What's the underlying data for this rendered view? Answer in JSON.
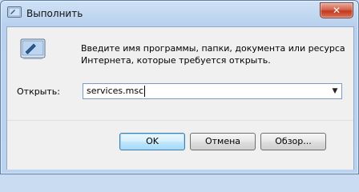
{
  "window": {
    "title": "Выполнить",
    "close_label": "✕"
  },
  "dialog": {
    "description": "Введите имя программы, папки, документа или ресурса Интернета, которые требуется открыть.",
    "open_label": "Открыть:",
    "command_value": "services.msc",
    "combo_arrow": "▼"
  },
  "buttons": {
    "ok": "OK",
    "cancel": "Отмена",
    "browse": "Обзор..."
  },
  "colors": {
    "titlebar": "#cfe1f5",
    "close_button": "#c2391f",
    "default_button_border": "#3c7fb1"
  },
  "icons": {
    "title": "run-icon",
    "app": "run-dialog-icon"
  }
}
